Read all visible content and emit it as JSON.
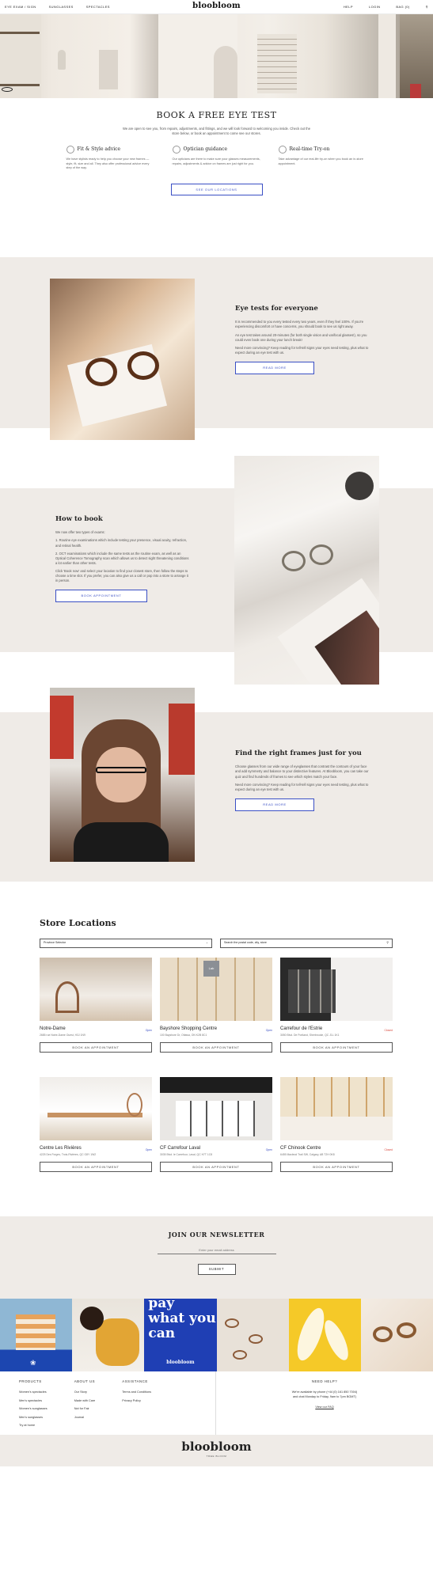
{
  "nav": {
    "left": [
      "EYE EXAM / SIGN",
      "SUNGLASSES",
      "SPECTACLES"
    ],
    "logo": "bloobloom",
    "right": [
      "HELP",
      "LOGIN",
      "BAG (0)"
    ]
  },
  "eye_test": {
    "title": "BOOK A FREE EYE TEST",
    "intro": "We are open to see you, from repairs, adjustments, and fittings, and we will look forward to welcoming you inside. Check out the store below, or book an appointment to come see our stores.",
    "features": [
      {
        "title": "Fit & Style advice",
        "icon": "glasses-icon",
        "text": "We have stylists ready to help you choose your new frames — style, fit, size and all. They also offer professional advice every step of the way."
      },
      {
        "title": "Optician guidance",
        "icon": "person-icon",
        "text": "Our opticians are there to make sure your glasses measurements, repairs, adjustments & advice on frames are just right for you."
      },
      {
        "title": "Real-time Try-on",
        "icon": "mirror-icon",
        "text": "Take advantage of our real-life try-on when you book an in-store appointment."
      }
    ],
    "button": "SEE OUR LOCATIONS"
  },
  "sections": [
    {
      "title": "Eye tests for everyone",
      "paragraphs": [
        "It is recommended to you every tested every two years, even if they feel 100%. If you're experiencing discomfort or have concerns, you should book to see us right away.",
        "An eye test takes around 20-minutes (for both single vision and varifocal glasses!), so you could even book one during your lunch break!",
        "Need more convincing? Keep reading for tell-tell signs your eyes need testing, plus what to expect during an eye test with us."
      ],
      "button": "READ MORE"
    },
    {
      "title": "How to book",
      "paragraphs": [
        "We now offer two types of exams:",
        "1. Routine eye examinations which include testing your presence, visual acuity, refraction, and retinal health.",
        "2. OCT examinations which include the same tests as the routine exam, as well as an Optical Coherence Tomography scan which allows us to detect sight threatening conditions a lot earlier than other tests.",
        "Click 'Book now' and select your location to find your closest store, then follow the steps to choose a time slot. If you prefer, you can also give us a call or pop into a store to arrange it in person."
      ],
      "button": "BOOK APPOINTMENT"
    },
    {
      "title": "Find the right frames just for you",
      "paragraphs": [
        "Choose glasses from our wide range of eyeglasses that contrast the contours of your face and add symmetry and balance to your distinctive features. At Bloobloom, you can take our quiz and find hundreds of frames to see which styles match your face.",
        "Need more convincing? Keep reading for tell-tell signs your eyes need testing, plus what to expect during an eye test with us."
      ],
      "button": "READ MORE"
    }
  ],
  "stores": {
    "title": "Store Locations",
    "province": "Province Selector",
    "search_placeholder": "Search the postal code, city, store",
    "items": [
      {
        "name": "Notre-Dame",
        "status": "Open",
        "address": "2685 rue Notre-Dame Ouest, H3J 1N9",
        "button": "BOOK AN APPOINTMENT"
      },
      {
        "name": "Bayshore Shopping Centre",
        "status": "Open",
        "address": "100 Bayshore Dr, Ottawa, ON K2B 8C1",
        "button": "BOOK AN APPOINTMENT"
      },
      {
        "name": "Carrefour de l'Estrie",
        "status": "Closed",
        "address": "3050 Blvd. De Portland, Sherbrooke, QC J1L 1K1",
        "button": "BOOK AN APPOINTMENT"
      },
      {
        "name": "Centre Les Rivières",
        "status": "Open",
        "address": "4225 Des Forges, Trois-Rivières, QC G8Y 1W2",
        "button": "BOOK AN APPOINTMENT"
      },
      {
        "name": "CF Carrefour Laval",
        "status": "Open",
        "address": "3035 Blvd. le Carrefour, Laval, QC H7T 1C8",
        "button": "BOOK AN APPOINTMENT"
      },
      {
        "name": "CF Chinook Centre",
        "status": "Closed",
        "address": "6455 Macleod Trail SW, Calgary, AB T2H 0K8",
        "button": "BOOK AN APPOINTMENT"
      }
    ]
  },
  "newsletter": {
    "title": "JOIN OUR NEWSLETTER",
    "placeholder": "Enter your email address",
    "button": "SUBMIT"
  },
  "promo": {
    "line1": "pay",
    "line2": "what you",
    "line3": "can",
    "brand": "bloobloom"
  },
  "footer": {
    "products": {
      "title": "PRODUCTS",
      "links": [
        "Women's spectacles",
        "Men's spectacles",
        "Women's sunglasses",
        "Men's sunglasses",
        "Try at home"
      ]
    },
    "about": {
      "title": "ABOUT US",
      "links": [
        "Our Story",
        "Made with Care",
        "Not for Fair",
        "Journal"
      ]
    },
    "assistance": {
      "title": "ASSISTANCE",
      "links": [
        "Terms and Conditions",
        "Privacy Policy"
      ]
    },
    "help": {
      "title": "NEED HELP?",
      "line1": "We're available by phone (+44 (0) 161 850 7004)",
      "line2": "and chat Monday to Friday, 9am to 7pm BGMT)",
      "faq": "View our FAQ"
    }
  },
  "bottom": {
    "logo": "bloobloom",
    "tag": "TREE BLOOM"
  },
  "colors": {
    "accent": "#3a4fc4",
    "band": "#efebe7",
    "open": "#3a4fc4",
    "closed": "#d9463a"
  }
}
